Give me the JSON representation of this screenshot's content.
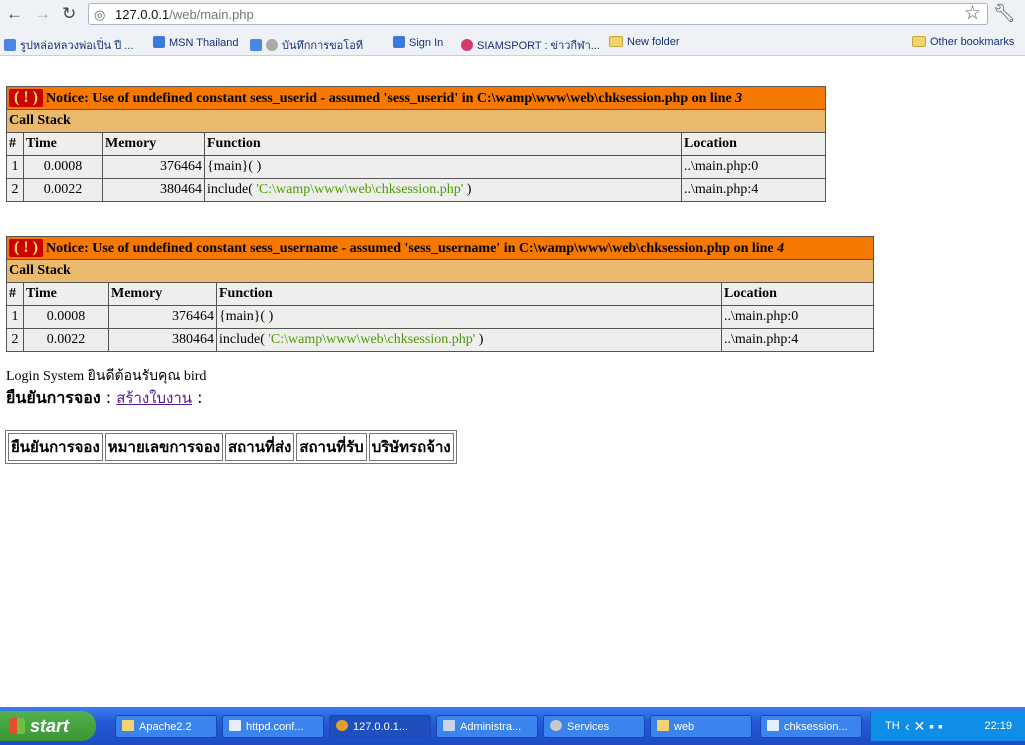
{
  "browser": {
    "url_host": "127.0.0.1",
    "url_path": "/web/main.php",
    "bookmarks": [
      "รูปหล่อหลวงพ่อเปิ่น ปี ...",
      "MSN Thailand",
      "บันทึกการขอโอที",
      "Sign In",
      "SIAMSPORT : ข่าวกีฬา...",
      "New folder"
    ],
    "other_bookmarks": "Other bookmarks"
  },
  "notices": [
    {
      "bang": "( ! )",
      "message": "Notice: Use of undefined constant sess_userid - assumed 'sess_userid' in C:\\wamp\\www\\web\\chksession.php on line ",
      "line": "3",
      "call_stack_label": "Call Stack",
      "headers": [
        "#",
        "Time",
        "Memory",
        "Function",
        "Location"
      ],
      "rows": [
        {
          "num": "1",
          "time": "0.0008",
          "memory": "376464",
          "func": "{main}( )",
          "arg": "",
          "func_close": "",
          "location": "..\\main.php:0"
        },
        {
          "num": "2",
          "time": "0.0022",
          "memory": "380464",
          "func": "include( ",
          "arg": "'C:\\wamp\\www\\web\\chksession.php'",
          "func_close": " )",
          "location": "..\\main.php:4"
        }
      ]
    },
    {
      "bang": "( ! )",
      "message": "Notice: Use of undefined constant sess_username - assumed 'sess_username' in C:\\wamp\\www\\web\\chksession.php on line ",
      "line": "4",
      "call_stack_label": "Call Stack",
      "headers": [
        "#",
        "Time",
        "Memory",
        "Function",
        "Location"
      ],
      "rows": [
        {
          "num": "1",
          "time": "0.0008",
          "memory": "376464",
          "func": "{main}( )",
          "arg": "",
          "func_close": "",
          "location": "..\\main.php:0"
        },
        {
          "num": "2",
          "time": "0.0022",
          "memory": "380464",
          "func": "include( ",
          "arg": "'C:\\wamp\\www\\web\\chksession.php'",
          "func_close": " )",
          "location": "..\\main.php:4"
        }
      ]
    }
  ],
  "page": {
    "login_text": "Login System ยินดีต้อนรับคุณ bird",
    "confirm_label": "ยืนยันการจอง",
    "separator": " : ",
    "create_link": "สร้างใบงาน",
    "trailing": " :",
    "table_headers": [
      "ยืนยันการจอง",
      "หมายเลขการจอง",
      "สถานที่ส่ง",
      "สถานที่รับ",
      "บริษัทรถจ้าง"
    ]
  },
  "taskbar": {
    "start": "start",
    "tasks": [
      "Apache2.2",
      "httpd.conf...",
      "127.0.0.1...",
      "Administra...",
      "Services",
      "web",
      "chksession..."
    ],
    "lang": "TH",
    "clock": "22:19"
  }
}
